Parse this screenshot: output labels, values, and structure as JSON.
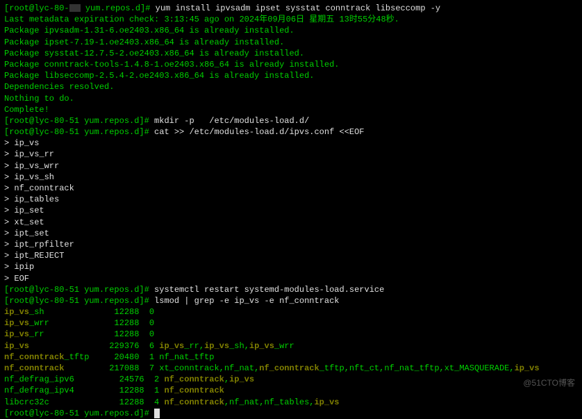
{
  "prompt1_host": "[root@lyc-80-",
  "prompt1_path": " yum.repos.d]# ",
  "cmd1": "yum install ipvsadm ipset sysstat conntrack libseccomp -y",
  "yum_output": [
    "Last metadata expiration check: 3:13:45 ago on 2024年09月06日 星期五 13时55分48秒.",
    "Package ipvsadm-1.31-6.oe2403.x86_64 is already installed.",
    "Package ipset-7.19-1.oe2403.x86_64 is already installed.",
    "Package sysstat-12.7.5-2.oe2403.x86_64 is already installed.",
    "Package conntrack-tools-1.4.8-1.oe2403.x86_64 is already installed.",
    "Package libseccomp-2.5.4-2.oe2403.x86_64 is already installed.",
    "Dependencies resolved.",
    "Nothing to do.",
    "Complete!"
  ],
  "prompt2": "[root@lyc-80-51 yum.repos.d]# ",
  "cmd2": "mkdir -p   /etc/modules-load.d/",
  "prompt3": "[root@lyc-80-51 yum.repos.d]# ",
  "cmd3": "cat >> /etc/modules-load.d/ipvs.conf <<EOF",
  "heredoc": [
    "> ip_vs",
    "> ip_vs_rr",
    "> ip_vs_wrr",
    "> ip_vs_sh",
    "> nf_conntrack",
    "> ip_tables",
    "> ip_set",
    "> xt_set",
    "> ipt_set",
    "> ipt_rpfilter",
    "> ipt_REJECT",
    "> ipip",
    "> EOF"
  ],
  "prompt4": "[root@lyc-80-51 yum.repos.d]# ",
  "cmd4": "systemctl restart systemd-modules-load.service",
  "prompt5": "[root@lyc-80-51 yum.repos.d]# ",
  "cmd5": "lsmod | grep -e ip_vs -e nf_conntrack",
  "lsmod": [
    {
      "pre": "",
      "h1": "ip_vs",
      "mid": "_sh              12288  0",
      "tail": ""
    },
    {
      "pre": "",
      "h1": "ip_vs",
      "mid": "_wrr             12288  0",
      "tail": ""
    },
    {
      "pre": "",
      "h1": "ip_vs",
      "mid": "_rr              12288  0",
      "tail": ""
    },
    {
      "pre": "",
      "h1": "ip_vs",
      "mid": "                229376  6 ",
      "tail_parts": [
        {
          "t": "ip_vs",
          "b": true
        },
        {
          "t": "_rr,",
          "b": false
        },
        {
          "t": "ip_vs",
          "b": true
        },
        {
          "t": "_sh,",
          "b": false
        },
        {
          "t": "ip_vs",
          "b": true
        },
        {
          "t": "_wrr",
          "b": false
        }
      ]
    },
    {
      "pre": "",
      "h1": "nf_conntrack",
      "mid": "_tftp     20480  1 nf_nat_tftp",
      "tail": ""
    },
    {
      "pre": "",
      "h1": "nf_conntrack",
      "mid": "         217088  7 xt_conntrack,nf_nat,",
      "tail_parts": [
        {
          "t": "nf_conntrack",
          "b": true
        },
        {
          "t": "_tftp,nft_ct,nf_nat_tftp,xt_MASQUERADE,",
          "b": false
        },
        {
          "t": "ip_vs",
          "b": true
        }
      ]
    },
    {
      "pre": "nf_defrag_ipv6         24576  2 ",
      "h1": "nf_conntrack",
      "mid": ",",
      "tail_parts": [
        {
          "t": "ip_vs",
          "b": true
        }
      ]
    },
    {
      "pre": "nf_defrag_ipv4         12288  1 ",
      "h1": "nf_conntrack",
      "mid": "",
      "tail": ""
    },
    {
      "pre": "libcrc32c              12288  4 ",
      "h1": "nf_conntrack",
      "mid": ",nf_nat,nf_tables,",
      "tail_parts": [
        {
          "t": "ip_vs",
          "b": true
        }
      ]
    }
  ],
  "prompt6": "[root@lyc-80-51 yum.repos.d]# ",
  "watermark": "@51CTO博客"
}
